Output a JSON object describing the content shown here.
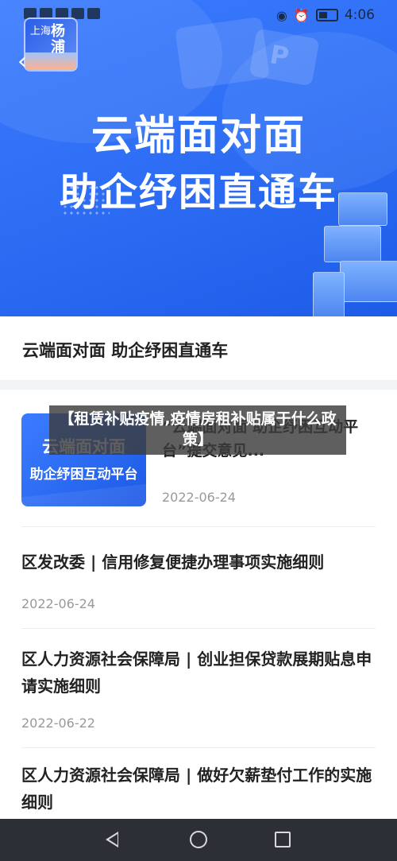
{
  "status_bar": {
    "time": "4:06"
  },
  "logo": {
    "line1": "上海",
    "line2": "杨浦"
  },
  "banner": {
    "title_line1": "云端面对面",
    "title_line2": "助企纾困直通车",
    "bubble_letter": "P"
  },
  "article": {
    "title": "云端面对面 助企纾困直通车"
  },
  "overlay": {
    "text": "【租赁补贴疫情,疫情房租补贴属于什么政策】"
  },
  "items": [
    {
      "thumb_line1": "云端面对面",
      "thumb_line2": "助企纾困互动平台",
      "title": "“云端面对面 助企纾困互动平台”提交意见...",
      "date": "2022-06-24"
    },
    {
      "title": "区发改委 | 信用修复便捷办理事项实施细则",
      "date": "2022-06-24"
    },
    {
      "title": "区人力资源社会保障局 | 创业担保贷款展期贴息申请实施细则",
      "date": "2022-06-22"
    },
    {
      "title": "区人力资源社会保障局 | 做好欠薪垫付工作的实施细则"
    }
  ],
  "icons": [
    "back-arrow-icon",
    "nav-back-icon",
    "nav-home-icon",
    "nav-recent-icon",
    "battery-icon",
    "eye-icon",
    "alarm-icon"
  ]
}
